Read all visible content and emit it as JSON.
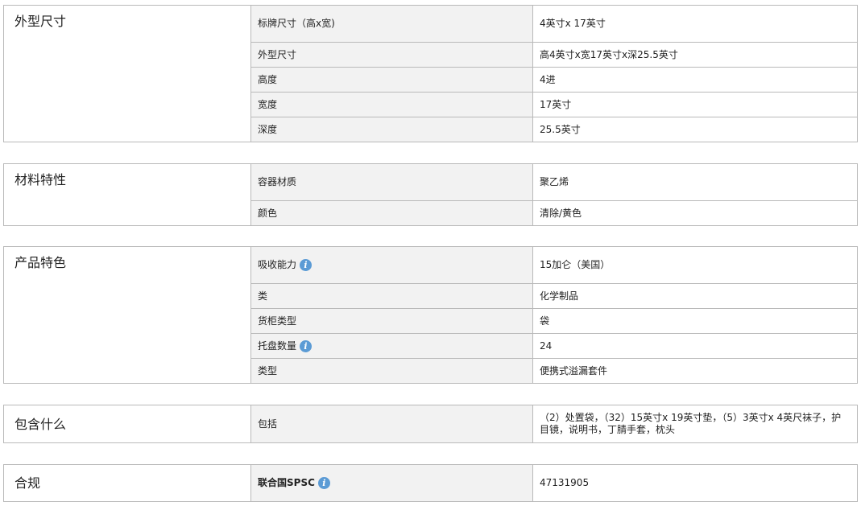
{
  "sections": {
    "dimensions": {
      "title": "外型尺寸",
      "rows": [
        {
          "label": "标牌尺寸（高x宽)",
          "value": "4英寸x 17英寸"
        },
        {
          "label": "外型尺寸",
          "value": "高4英寸x宽17英寸x深25.5英寸"
        },
        {
          "label": "高度",
          "value": "4进"
        },
        {
          "label": "宽度",
          "value": "17英寸"
        },
        {
          "label": "深度",
          "value": "25.5英寸"
        }
      ]
    },
    "material": {
      "title": "材料特性",
      "rows": [
        {
          "label": "容器材质",
          "value": "聚乙烯"
        },
        {
          "label": "颜色",
          "value": "清除/黄色"
        }
      ]
    },
    "features": {
      "title": "产品特色",
      "rows": [
        {
          "label": "吸收能力",
          "value": "15加仑（美国）",
          "info_icon": "info-icon"
        },
        {
          "label": "类",
          "value": "化学制品"
        },
        {
          "label": "货柜类型",
          "value": "袋"
        },
        {
          "label": "托盘数量",
          "value": "24",
          "info_icon": "info-icon"
        },
        {
          "label": "类型",
          "value": "便携式溢漏套件"
        }
      ]
    },
    "included": {
      "title": "包含什么",
      "rows": [
        {
          "label": "包括",
          "value": "（2）处置袋，（32）15英寸x 19英寸垫，（5）3英寸x 4英尺袜子，护目镜，说明书，丁腈手套，枕头"
        }
      ]
    },
    "compliance": {
      "title": "合规",
      "rows": [
        {
          "label": "联合国SPSC",
          "value": "47131905",
          "info_icon": "info-icon"
        }
      ]
    }
  },
  "colors": {
    "label_bg": "#f2f2f2",
    "border": "#b9b9b9",
    "info_icon": "#5b9bd5"
  }
}
